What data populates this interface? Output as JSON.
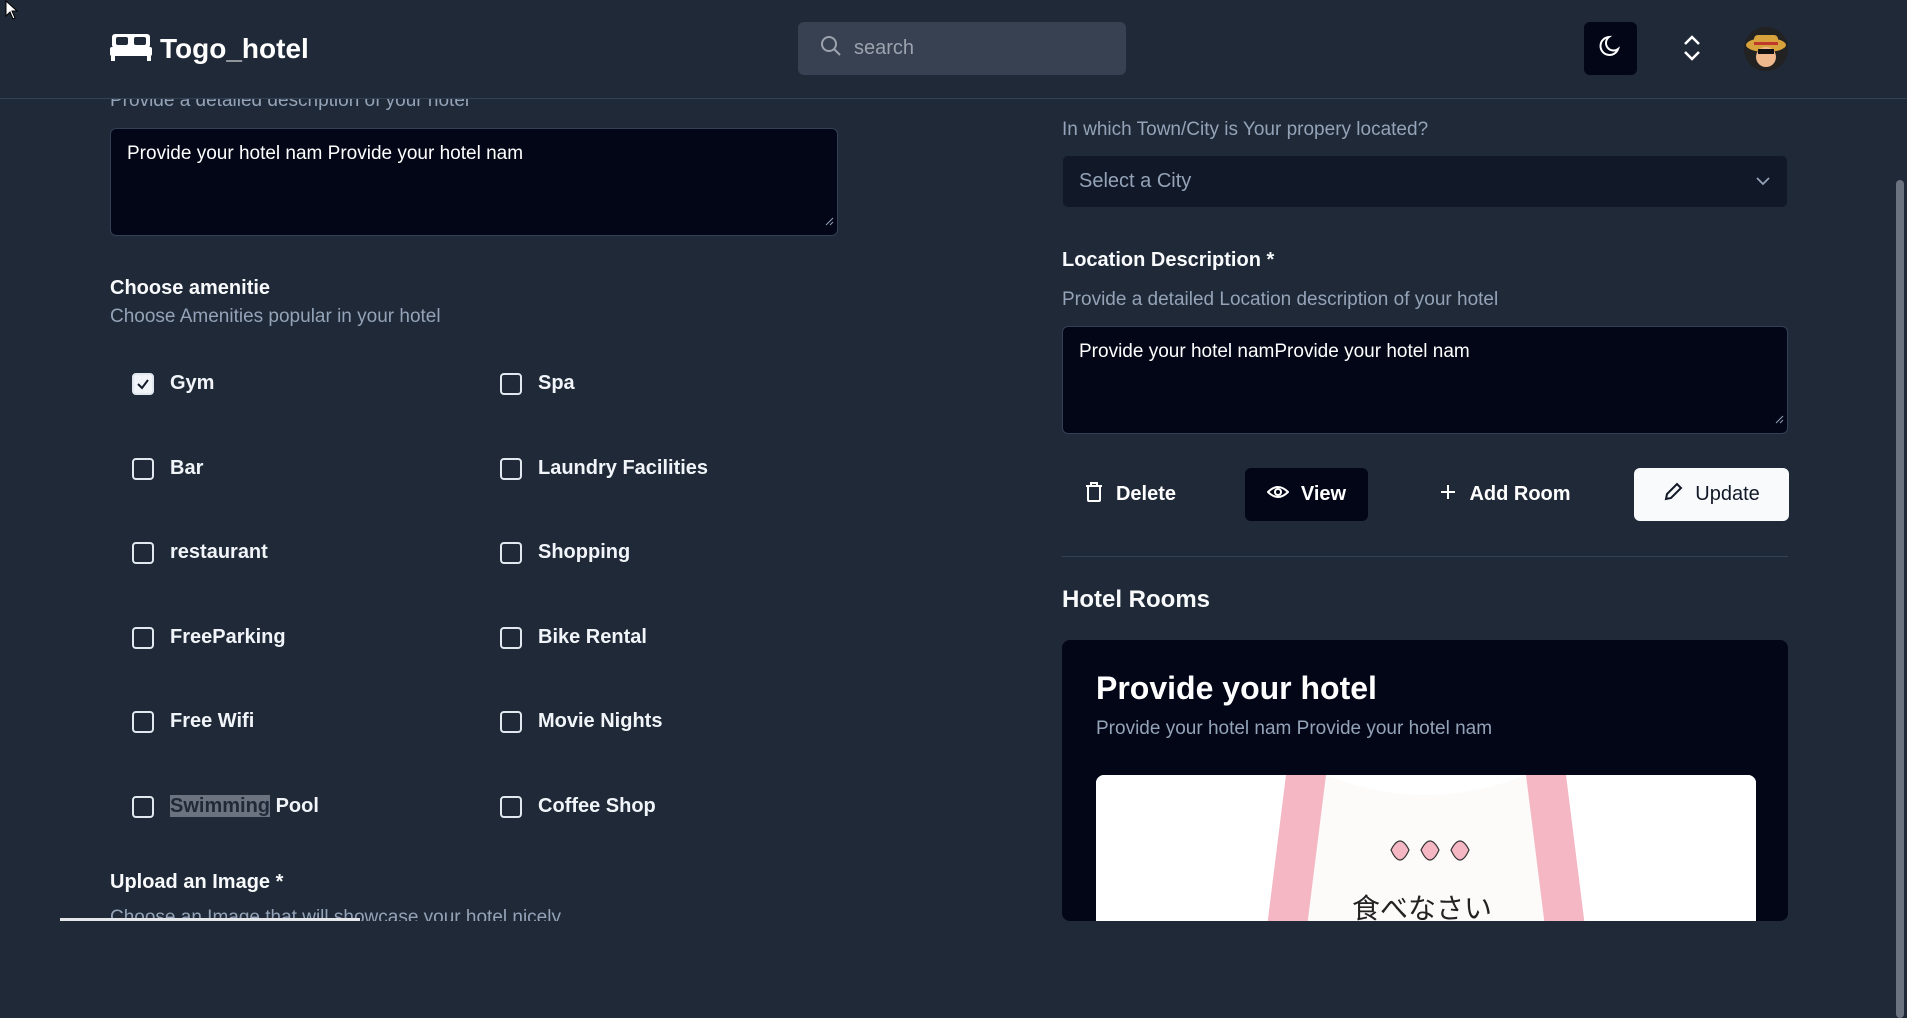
{
  "header": {
    "logo_text": "Togo_hotel",
    "search_placeholder": "search"
  },
  "left": {
    "description_hint": "Provide a detailed description of your hotel",
    "description_value": "Provide your hotel nam Provide your hotel nam",
    "amenities_title": "Choose amenitie",
    "amenities_hint": "Choose Amenities popular in your hotel",
    "amenities": [
      {
        "label": "Gym",
        "checked": true
      },
      {
        "label": "Spa",
        "checked": false
      },
      {
        "label": "Bar",
        "checked": false
      },
      {
        "label": "Laundry Facilities",
        "checked": false
      },
      {
        "label": "restaurant",
        "checked": false
      },
      {
        "label": "Shopping",
        "checked": false
      },
      {
        "label": "FreeParking",
        "checked": false
      },
      {
        "label": "Bike Rental",
        "checked": false
      },
      {
        "label": "Free Wifi",
        "checked": false
      },
      {
        "label": "Movie Nights",
        "checked": false
      },
      {
        "label_highlight": "Swimming",
        "label_rest": " Pool",
        "checked": false
      },
      {
        "label": "Coffee Shop",
        "checked": false
      }
    ],
    "upload_title": "Upload an Image *",
    "upload_hint": "Choose an Image that will showcase your hotel nicely"
  },
  "right": {
    "city_hint": "In which Town/City is Your propery located?",
    "city_select": "Select a City",
    "location_title": "Location Description *",
    "location_hint": "Provide a detailed Location description of your hotel",
    "location_value": "Provide your hotel namProvide your hotel nam",
    "buttons": {
      "delete": "Delete",
      "view": "View",
      "add_room": "Add Room",
      "update": "Update"
    },
    "rooms_title": "Hotel Rooms",
    "room_card": {
      "title": "Provide your hotel",
      "subtitle": "Provide your hotel nam Provide your hotel nam",
      "image_text": "食べなさい"
    }
  }
}
